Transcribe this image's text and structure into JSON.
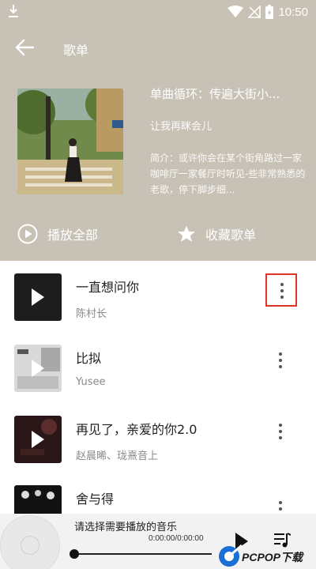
{
  "status_bar": {
    "time": "10:50"
  },
  "header": {
    "title": "歌单"
  },
  "playlist": {
    "name": "单曲循环：传遍大街小...",
    "creator": "让我再眯会儿",
    "description": "简介：或许你会在某个街角路过一家咖啡厅一家餐厅时听见-些非常熟悉的老歌，停下脚步细..."
  },
  "actions": {
    "play_all": "播放全部",
    "collect": "收藏歌单"
  },
  "songs": [
    {
      "title": "一直想问你",
      "artist": "陈村长"
    },
    {
      "title": "比拟",
      "artist": "Yusee"
    },
    {
      "title": "再见了，亲爱的你2.0",
      "artist": "赵晨晞、珑熹音上"
    },
    {
      "title": "舍与得",
      "artist": ""
    }
  ],
  "player": {
    "message": "请选择需要播放的音乐",
    "time": "0:00:00/0:00:00",
    "progress": 0
  },
  "watermark": "PCPOP下载",
  "colors": {
    "header_bg": "#c8c1b6",
    "highlight": "#e0342c",
    "player_bg": "#f2f2f2"
  }
}
